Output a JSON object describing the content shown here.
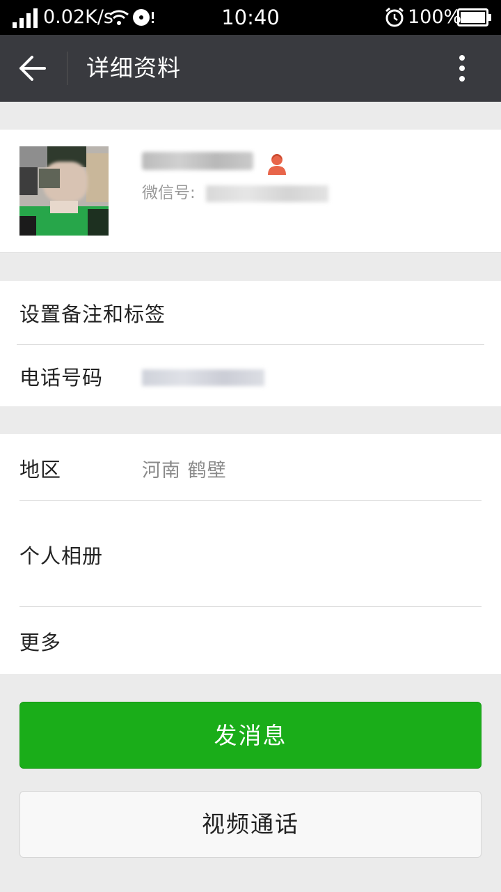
{
  "status_bar": {
    "network_speed": "0.02K/s",
    "time": "10:40",
    "battery": "100%"
  },
  "title_bar": {
    "title": "详细资料"
  },
  "profile": {
    "wechat_id_label": "微信号:"
  },
  "rows": {
    "set_remark": "设置备注和标签",
    "phone_label": "电话号码",
    "region_label": "地区",
    "region_value": "河南  鹤壁",
    "album_label": "个人相册",
    "more_label": "更多"
  },
  "buttons": {
    "send_message": "发消息",
    "video_call": "视频通话"
  },
  "colors": {
    "primary_green": "#1aad19",
    "title_bar_bg": "#393a3f",
    "gender_female": "#e8654a"
  },
  "icons": [
    "signal-icon",
    "wifi-icon",
    "disc-icon",
    "alarm-icon",
    "battery-icon",
    "back-arrow-icon",
    "more-vertical-icon",
    "female-gender-icon"
  ]
}
